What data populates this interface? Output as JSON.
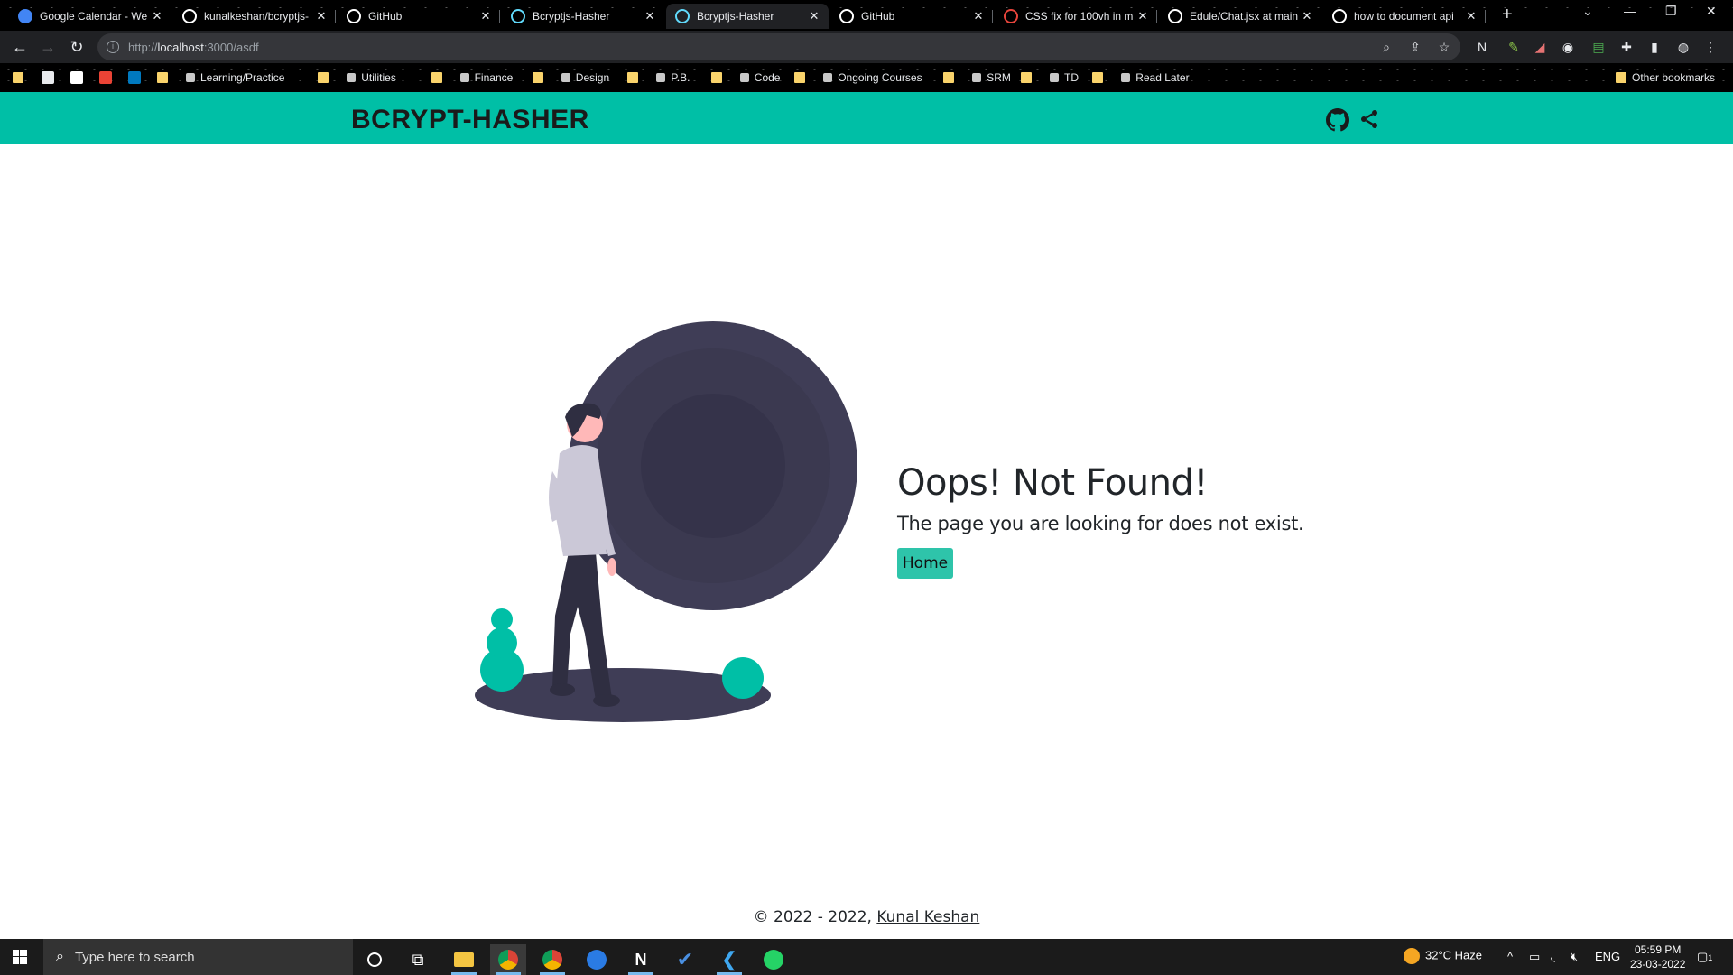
{
  "browser": {
    "tabs": [
      {
        "title": "Google Calendar - We",
        "icon": "calendar-icon",
        "color": "#4285f4"
      },
      {
        "title": "kunalkeshan/bcryptjs-",
        "icon": "github-icon",
        "color": "#ffffff"
      },
      {
        "title": "GitHub",
        "icon": "github-icon",
        "color": "#ffffff"
      },
      {
        "title": "Bcryptjs-Hasher",
        "icon": "react-icon",
        "color": "#61dafb"
      },
      {
        "title": "Bcryptjs-Hasher",
        "icon": "react-icon",
        "color": "#61dafb"
      },
      {
        "title": "GitHub",
        "icon": "github-icon",
        "color": "#ffffff"
      },
      {
        "title": "CSS fix for 100vh in m",
        "icon": "asterisk-icon",
        "color": "#e8453c"
      },
      {
        "title": "Edule/Chat.jsx at main",
        "icon": "github-icon",
        "color": "#ffffff"
      },
      {
        "title": "how to document api",
        "icon": "google-icon",
        "color": "#ffffff"
      }
    ],
    "active_tab_index": 4,
    "url": {
      "scheme": "http://",
      "host": "localhost",
      "path": ":3000/asdf"
    },
    "bookmarks": [
      {
        "label": "",
        "kind": "folder"
      },
      {
        "label": "",
        "kind": "mail"
      },
      {
        "label": "",
        "kind": "github"
      },
      {
        "label": "",
        "kind": "calendar"
      },
      {
        "label": "",
        "kind": "trello"
      },
      {
        "label": "",
        "kind": "folder"
      },
      {
        "label": "Learning/Practice",
        "kind": "link"
      },
      {
        "label": "",
        "kind": "folder"
      },
      {
        "label": "Utilities",
        "kind": "link"
      },
      {
        "label": "",
        "kind": "folder"
      },
      {
        "label": "Finance",
        "kind": "link"
      },
      {
        "label": "",
        "kind": "folder"
      },
      {
        "label": "Design",
        "kind": "link"
      },
      {
        "label": "",
        "kind": "folder"
      },
      {
        "label": "P.B.",
        "kind": "link"
      },
      {
        "label": "",
        "kind": "folder"
      },
      {
        "label": "Code",
        "kind": "link"
      },
      {
        "label": "",
        "kind": "folder"
      },
      {
        "label": "Ongoing Courses",
        "kind": "link"
      },
      {
        "label": "",
        "kind": "folder"
      },
      {
        "label": "SRM",
        "kind": "link"
      },
      {
        "label": "",
        "kind": "folder"
      },
      {
        "label": "TD",
        "kind": "link"
      },
      {
        "label": "",
        "kind": "folder"
      },
      {
        "label": "Read Later",
        "kind": "link"
      }
    ],
    "other_bookmarks": "Other bookmarks"
  },
  "app": {
    "brand": "BCRYPT-HASHER",
    "brand_color": "#00bfa6",
    "not_found": {
      "title": "Oops! Not Found!",
      "message": "The page you are looking for does not exist.",
      "home_label": "Home"
    },
    "footer": {
      "copyright": "© 2022 - 2022,",
      "author": "Kunal Keshan"
    }
  },
  "taskbar": {
    "search_placeholder": "Type here to search",
    "weather": "32°C  Haze",
    "language": "ENG",
    "time": "05:59 PM",
    "date": "23-03-2022",
    "notifications": "1"
  }
}
